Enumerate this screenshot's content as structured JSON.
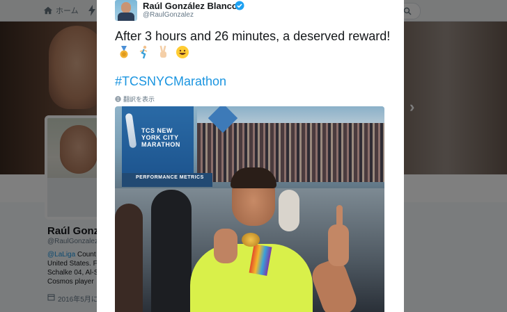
{
  "background_page": {
    "nav": {
      "home_label": "ホーム"
    },
    "profile": {
      "name": "Raúl Gonz",
      "handle": "@RaulGonzalez",
      "bio_lines": [
        {
          "link": "@LaLiga",
          "text": " Count"
        },
        {
          "text": "United States. F"
        },
        {
          "text": "Schalke 04, Al-S"
        },
        {
          "text": "Cosmos player"
        }
      ],
      "joined": "2016年5月に"
    }
  },
  "tweet": {
    "author": {
      "name": "Raúl González Blanco",
      "handle": "@RaulGonzalez",
      "verified": true
    },
    "text": "After 3 hours and 26 minutes, a deserved reward!",
    "emojis": [
      "medal-emoji",
      "runner-emoji",
      "victory-hand-emoji",
      "grinning-face-emoji"
    ],
    "hashtag": "#TCSNYCMarathon",
    "translate_label": "翻訳を表示",
    "photo": {
      "banner_text": "TCS NEW YORK CITY MARATHON",
      "metrics_text": "PERFORMANCE METRICS"
    }
  },
  "colors": {
    "link": "#1b95e0",
    "text": "#14171a",
    "muted": "#657786"
  }
}
